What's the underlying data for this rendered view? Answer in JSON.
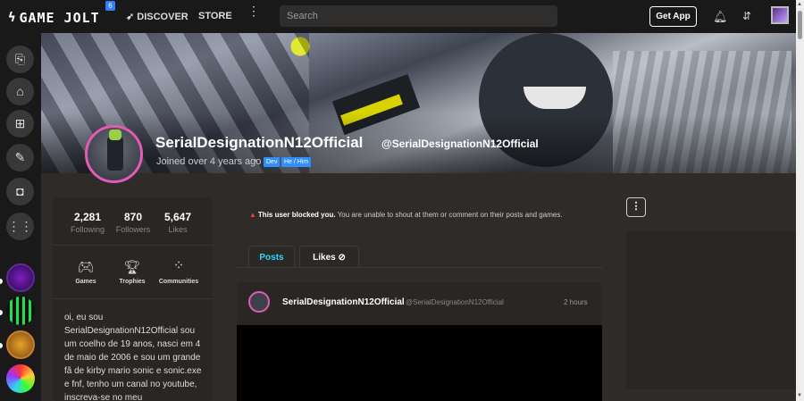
{
  "topbar": {
    "logo": "GAME JOLT",
    "notif_badge": "6",
    "discover": "DISCOVER",
    "store": "STORE",
    "more": "⋮",
    "search_placeholder": "Search",
    "get_app": "Get App"
  },
  "icons": {
    "logo": "lightning-bolt-icon",
    "discover": "rocket-icon",
    "more": "vertical-ellipsis-icon",
    "bell": "bell-icon",
    "friends": "friends-icon",
    "profile": "user-avatar",
    "sidebar": [
      "library-icon",
      "store-icon",
      "backpack-icon",
      "quests-icon",
      "realms-icon",
      "game-list-icon"
    ]
  },
  "colors": {
    "accent": "#2fd7ff",
    "blue_tag": "#2f8fff",
    "avatar_ring": "#e45ab7",
    "warning": "#ff3b3b"
  },
  "profile": {
    "display_name": "SerialDesignationN12Official",
    "username": "@SerialDesignationN12Official",
    "joined": "Joined over 4 years ago",
    "separator": "•",
    "tags": [
      "Dev",
      "He / Him"
    ]
  },
  "stats": {
    "following": {
      "value": "2,281",
      "label": "Following"
    },
    "followers": {
      "value": "870",
      "label": "Followers"
    },
    "likes": {
      "value": "5,647",
      "label": "Likes"
    }
  },
  "shortcuts": {
    "games": "Games",
    "trophies": "Trophies",
    "communities": "Communities"
  },
  "bio": "oi, eu sou SerialDesignationN12Official sou um coelho de 19 anos, nasci em 4 de maio de 2006 e sou um grande fã de kirby mario sonic e sonic.exe e fnf, tenho um canal no youtube, inscreva-se no meu",
  "blocked": {
    "title": "This user blocked you.",
    "message": "You are unable to shout at them or comment on their posts and games."
  },
  "tabs": {
    "posts": "Posts",
    "likes": "Likes"
  },
  "post": {
    "author": "SerialDesignationN12Official",
    "username": "@SerialDesignationN12Official",
    "time": "2 hours"
  },
  "right": {
    "menu": "⋮"
  }
}
